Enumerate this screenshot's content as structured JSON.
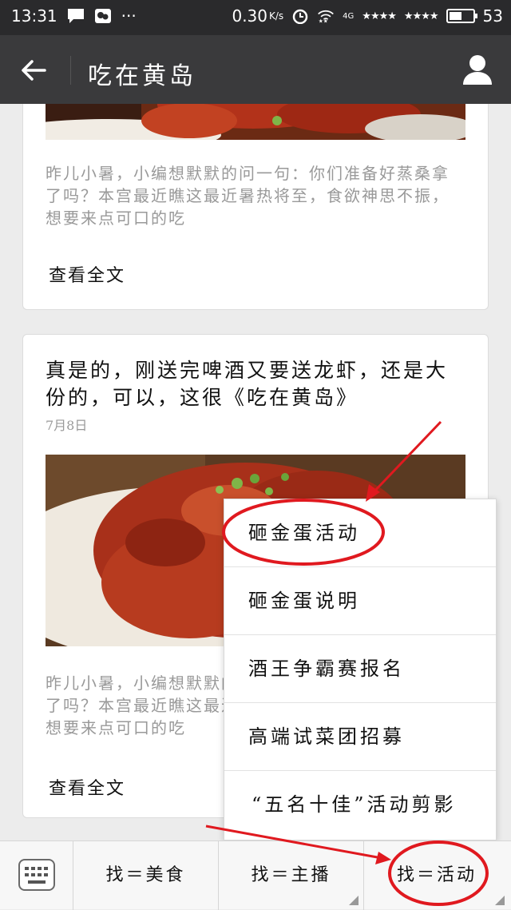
{
  "status_bar": {
    "time": "13:31",
    "net_speed": "0.30",
    "net_speed_unit": "K/s",
    "network_type": "4G",
    "battery_level_text": "53",
    "battery_fraction": 0.53,
    "icons": [
      "message-icon",
      "wechat-icon",
      "more-dots-icon",
      "alarm-icon",
      "wifi-icon",
      "signal-icon",
      "battery-icon"
    ]
  },
  "nav": {
    "title": "吃在黄岛",
    "back_icon": "back-arrow-icon",
    "profile_icon": "profile-icon"
  },
  "articles": [
    {
      "summary": "昨儿小暑，小编想默默的问一句：你们准备好蒸桑拿了吗？本宫最近瞧这最近暑热将至，食欲神思不振，想要来点可口的吃",
      "read_more": "查看全文"
    },
    {
      "title": "真是的，刚送完啤酒又要送龙虾，还是大份的，可以，这很《吃在黄岛》",
      "date": "7月8日",
      "summary": "昨儿小暑，小编想默默的问一句：你们准备好蒸桑拿了吗？本宫最近瞧这最近暑热将至，食欲神思不振，想要来点可口的吃",
      "read_more": "查看全文"
    }
  ],
  "popup_menu": {
    "items": [
      "砸金蛋活动",
      "砸金蛋说明",
      "酒王争霸赛报名",
      "高端试菜团招募",
      "“五名十佳”活动剪影"
    ]
  },
  "bottom_menu": {
    "keyboard_icon": "keyboard-icon",
    "tabs": [
      "找＝美食",
      "找＝主播",
      "找＝活动"
    ]
  },
  "colors": {
    "nav_bg": "#3a3a3c",
    "status_bg": "#2a2a2c",
    "annotation_red": "#e0191f"
  }
}
